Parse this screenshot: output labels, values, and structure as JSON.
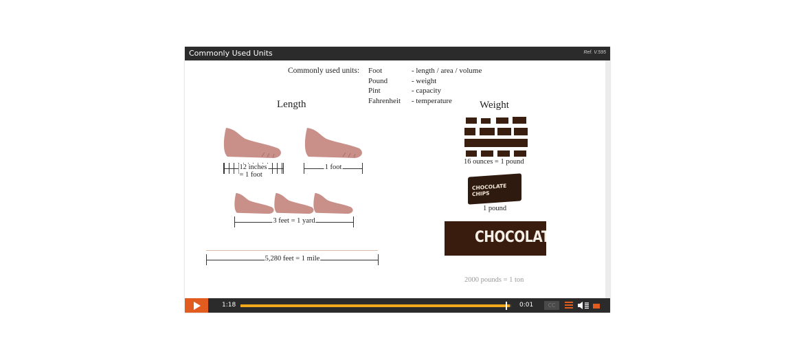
{
  "player": {
    "title": "Commonly Used Units",
    "ref": "Ref. V.595",
    "current_time": "1:18",
    "remaining_time": "0:01",
    "progress_fraction": 0.995,
    "cc_label": "CC",
    "accent_color": "#e25c1f",
    "progress_color": "#f2a81d"
  },
  "slide": {
    "units_label": "Commonly used units:",
    "units": [
      {
        "name": "Foot",
        "desc": "- length / area / volume"
      },
      {
        "name": "Pound",
        "desc": "- weight"
      },
      {
        "name": "Pint",
        "desc": "- capacity"
      },
      {
        "name": "Fahrenheit",
        "desc": "- temperature"
      }
    ],
    "length_heading": "Length",
    "weight_heading": "Weight",
    "length_captions": {
      "inches": "12 inches = 1 foot",
      "foot": "1 foot",
      "yard": "3 feet = 1 yard",
      "mile": "5,280 feet = 1 mile"
    },
    "weight_captions": {
      "ounces": "16 ounces = 1 pound",
      "pound": "1 pound",
      "ton": "2000 pounds = 1 ton"
    },
    "chips_label": "CHOCOLATE CHIPS",
    "chocolate_label": "CHOCOLATE"
  }
}
